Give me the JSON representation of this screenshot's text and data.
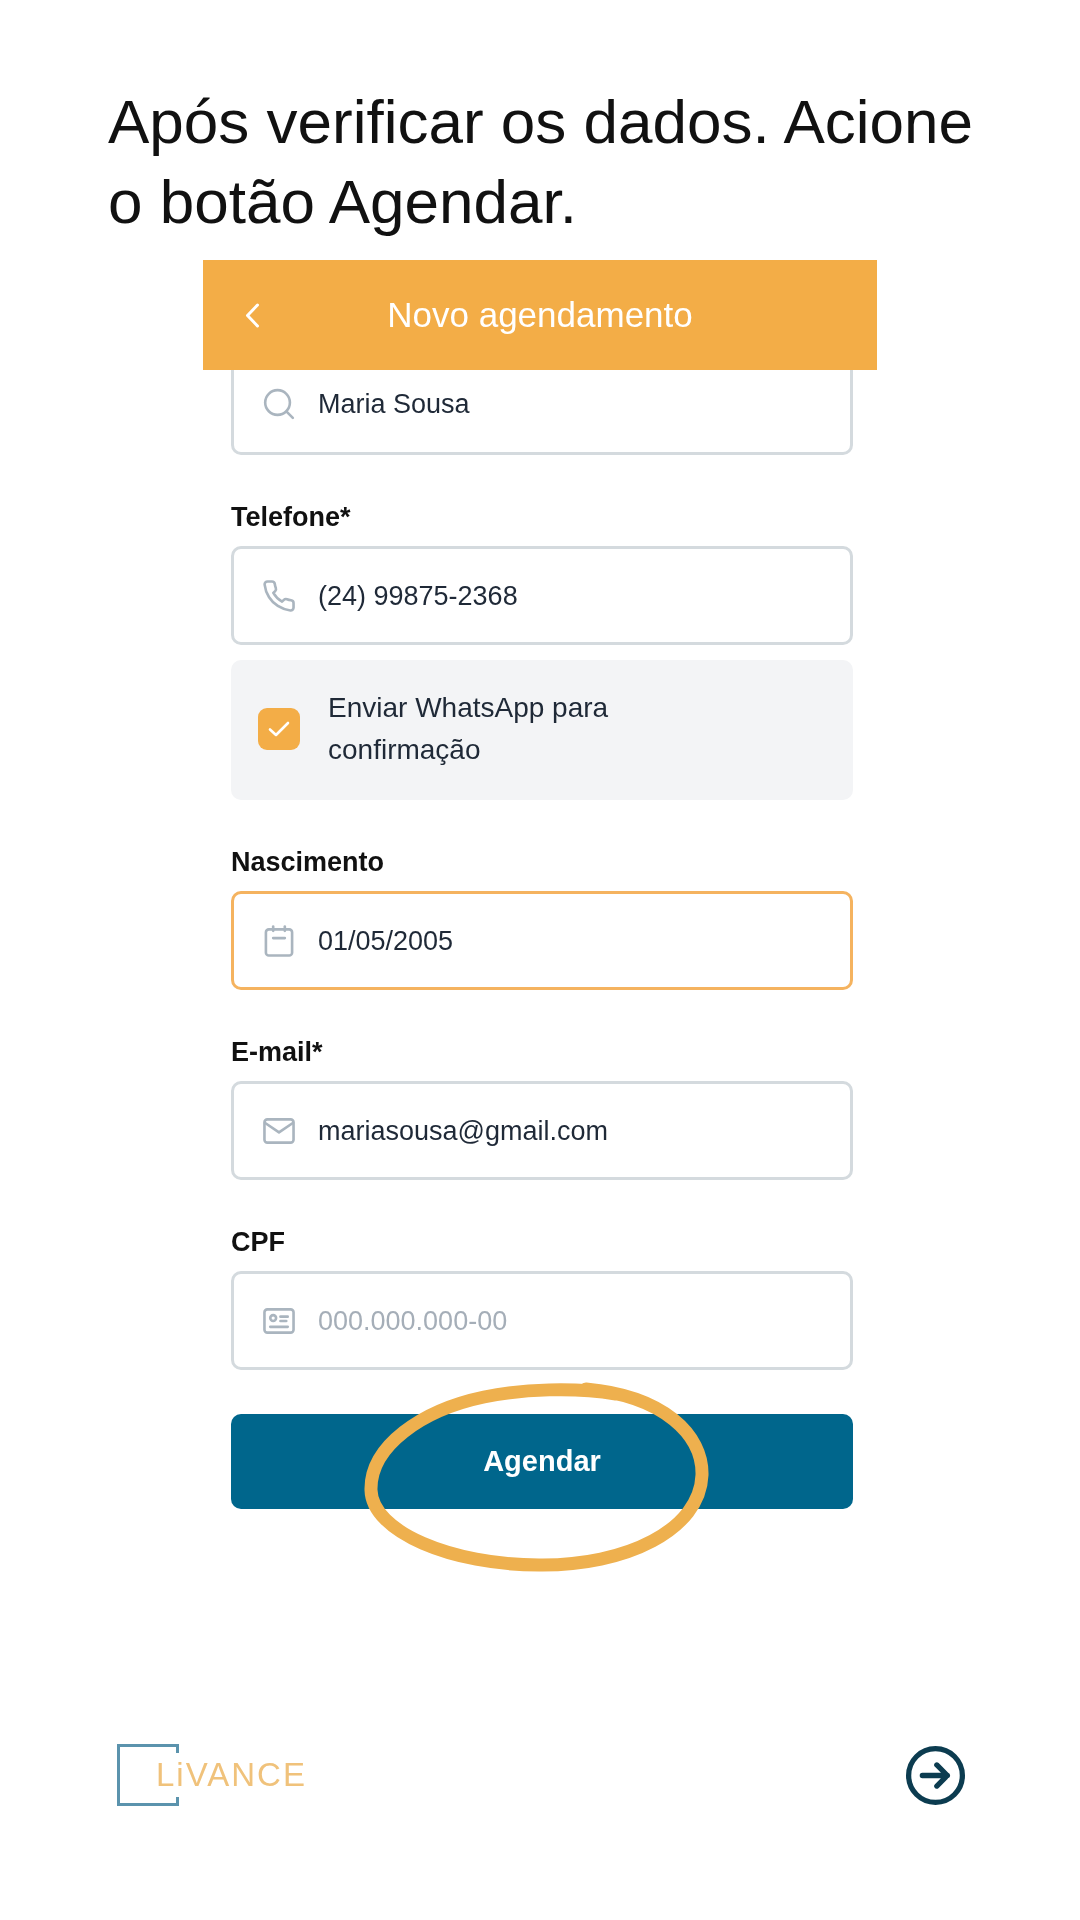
{
  "instruction": "Após verificar os dados. Acione o botão Agendar.",
  "header": {
    "title": "Novo agendamento"
  },
  "form": {
    "items": [
      {
        "kind": "search",
        "value": "Maria Sousa",
        "focused": false
      },
      {
        "kind": "phone",
        "label": "Telefone*",
        "value": "(24) 99875-2368",
        "focused": false
      },
      {
        "kind": "checkbox",
        "label": "Enviar WhatsApp para confirmação",
        "checked": true
      },
      {
        "kind": "date",
        "label": "Nascimento",
        "value": "01/05/2005",
        "focused": true
      },
      {
        "kind": "email",
        "label": "E-mail*",
        "value": "mariasousa@gmail.com",
        "focused": false
      },
      {
        "kind": "document",
        "label": "CPF",
        "placeholder": "000.000.000-00",
        "focused": false
      }
    ],
    "submit": {
      "label": "Agendar",
      "circled": true
    }
  },
  "footer": {
    "logo": "LiVANCE"
  }
}
